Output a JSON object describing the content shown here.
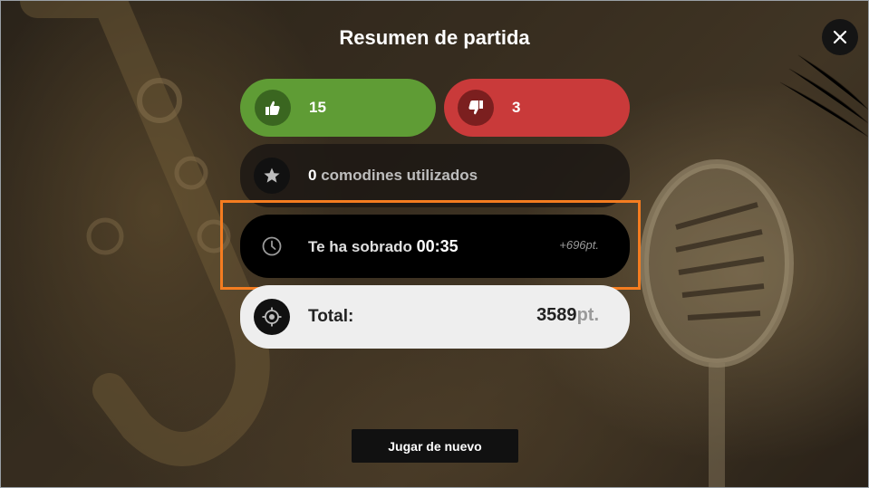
{
  "dialog": {
    "title": "Resumen de partida",
    "close_icon": "close-icon"
  },
  "results": {
    "correct": {
      "icon": "thumbs-up-icon",
      "count": "15",
      "color": "#5f9c35"
    },
    "wrong": {
      "icon": "thumbs-down-icon",
      "count": "3",
      "color": "#c93a3a"
    }
  },
  "wildcards": {
    "icon": "star-icon",
    "count": "0",
    "label": " comodines utilizados"
  },
  "time_left": {
    "icon": "clock-icon",
    "label": "Te ha sobrado ",
    "value": "00:35",
    "bonus": "+696pt."
  },
  "total": {
    "icon": "target-icon",
    "label": "Total:",
    "value": "3589",
    "unit": "pt."
  },
  "actions": {
    "replay_label": "Jugar de nuevo"
  },
  "colors": {
    "highlight": "#f47c20"
  }
}
